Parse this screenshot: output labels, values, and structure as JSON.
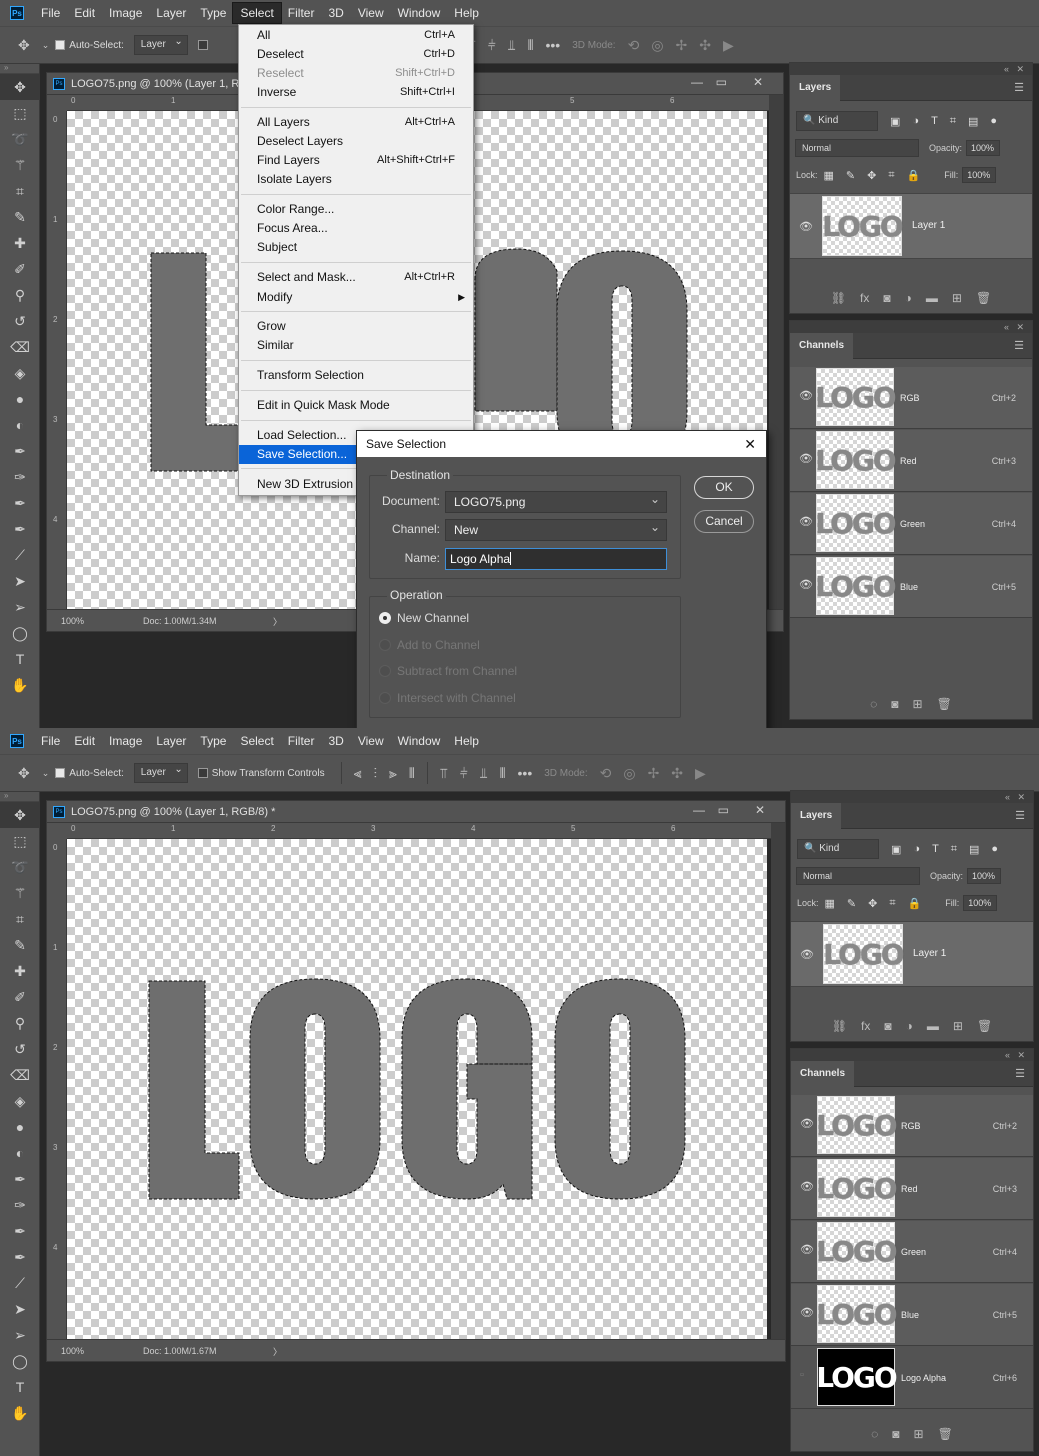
{
  "app": {
    "logo_text": "Ps"
  },
  "menubar": [
    "File",
    "Edit",
    "Image",
    "Layer",
    "Type",
    "Select",
    "Filter",
    "3D",
    "View",
    "Window",
    "Help"
  ],
  "options": {
    "auto_select_label": "Auto-Select:",
    "auto_select_value": "Layer",
    "show_transform_controls": "Show Transform Controls",
    "mode_3d": "3D Mode:"
  },
  "top": {
    "doc_title": "LOGO75.png @ 100% (Layer 1, R",
    "status_zoom": "100%",
    "status_doc": "Doc: 1.00M/1.34M"
  },
  "bottom": {
    "doc_title": "LOGO75.png @ 100% (Layer 1, RGB/8) *",
    "status_zoom": "100%",
    "status_doc": "Doc: 1.00M/1.67M"
  },
  "ruler": {
    "h_top": [
      "0",
      "1",
      "5",
      "6"
    ],
    "h_bot": [
      "0",
      "1",
      "2",
      "3",
      "4",
      "5",
      "6"
    ],
    "v": [
      "0",
      "1",
      "2",
      "3",
      "4"
    ]
  },
  "logo_text": "LOGO",
  "select_menu": {
    "items": [
      {
        "label": "All",
        "shortcut": "Ctrl+A"
      },
      {
        "label": "Deselect",
        "shortcut": "Ctrl+D"
      },
      {
        "label": "Reselect",
        "shortcut": "Shift+Ctrl+D"
      },
      {
        "label": "Inverse",
        "shortcut": "Shift+Ctrl+I"
      },
      {
        "label": "All Layers",
        "shortcut": "Alt+Ctrl+A"
      },
      {
        "label": "Deselect Layers",
        "shortcut": ""
      },
      {
        "label": "Find Layers",
        "shortcut": "Alt+Shift+Ctrl+F"
      },
      {
        "label": "Isolate Layers",
        "shortcut": ""
      },
      {
        "label": "Color Range...",
        "shortcut": ""
      },
      {
        "label": "Focus Area...",
        "shortcut": ""
      },
      {
        "label": "Subject",
        "shortcut": ""
      },
      {
        "label": "Select and Mask...",
        "shortcut": "Alt+Ctrl+R"
      },
      {
        "label": "Modify",
        "shortcut": ""
      },
      {
        "label": "Grow",
        "shortcut": ""
      },
      {
        "label": "Similar",
        "shortcut": ""
      },
      {
        "label": "Transform Selection",
        "shortcut": ""
      },
      {
        "label": "Edit in Quick Mask Mode",
        "shortcut": ""
      },
      {
        "label": "Load Selection...",
        "shortcut": ""
      },
      {
        "label": "Save Selection...",
        "shortcut": ""
      },
      {
        "label": "New 3D Extrusion",
        "shortcut": ""
      }
    ]
  },
  "dialog": {
    "title": "Save Selection",
    "destination": "Destination",
    "document_label": "Document:",
    "document_value": "LOGO75.png",
    "channel_label": "Channel:",
    "channel_value": "New",
    "name_label": "Name:",
    "name_value": "Logo Alpha",
    "ok": "OK",
    "cancel": "Cancel",
    "operation": "Operation",
    "ops": [
      "New Channel",
      "Add to Channel",
      "Subtract from Channel",
      "Intersect with Channel"
    ]
  },
  "layers_panel": {
    "tab": "Layers",
    "kind": "Kind",
    "blend_mode": "Normal",
    "opacity_label": "Opacity:",
    "opacity_value": "100%",
    "lock_label": "Lock:",
    "fill_label": "Fill:",
    "fill_value": "100%",
    "layer_name": "Layer 1"
  },
  "channels_panel": {
    "tab": "Channels",
    "channels": [
      {
        "name": "RGB",
        "shortcut": "Ctrl+2"
      },
      {
        "name": "Red",
        "shortcut": "Ctrl+3"
      },
      {
        "name": "Green",
        "shortcut": "Ctrl+4"
      },
      {
        "name": "Blue",
        "shortcut": "Ctrl+5"
      },
      {
        "name": "Logo Alpha",
        "shortcut": "Ctrl+6"
      }
    ]
  },
  "colors": {
    "accent": "#0a64d8",
    "ps_blue": "#31a8ff",
    "panel_bg": "#535353"
  }
}
